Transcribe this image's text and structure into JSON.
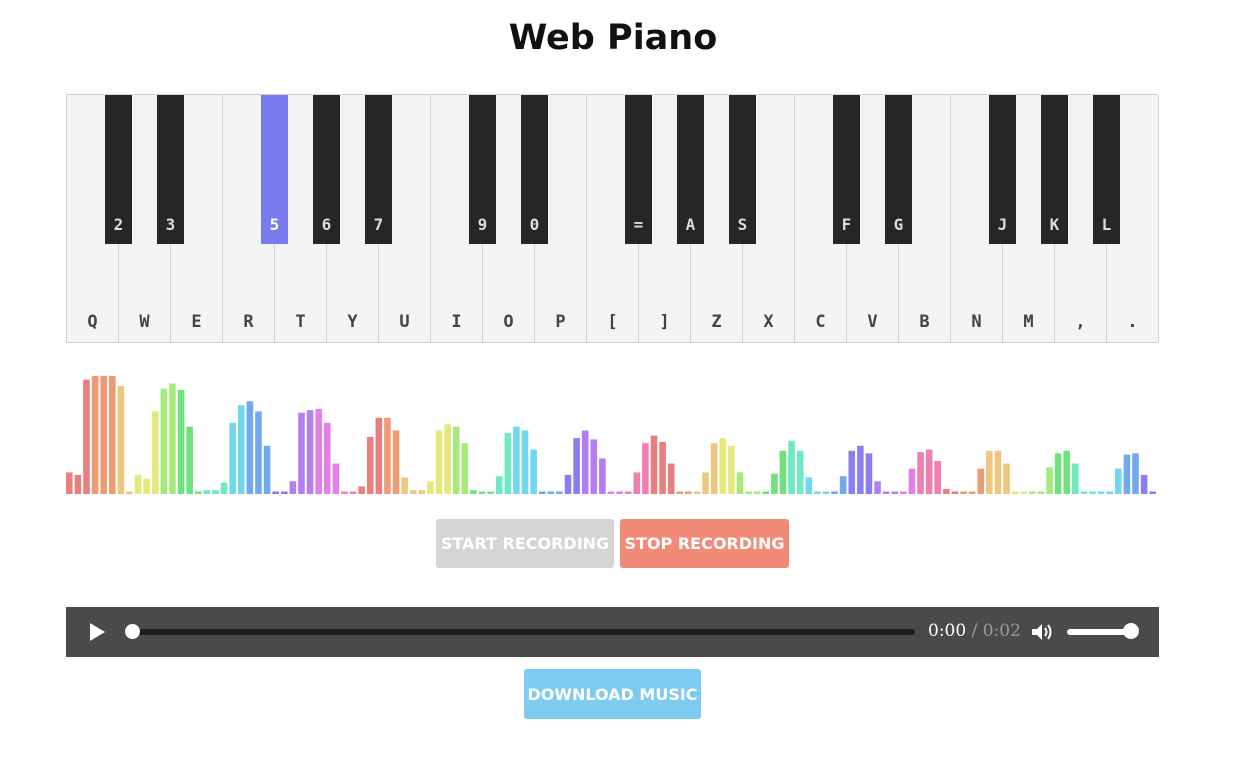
{
  "title": "Web Piano",
  "piano": {
    "white_keys": [
      "Q",
      "W",
      "E",
      "R",
      "T",
      "Y",
      "U",
      "I",
      "O",
      "P",
      "[",
      "]",
      "Z",
      "X",
      "C",
      "V",
      "B",
      "N",
      "M",
      ",",
      "."
    ],
    "black_keys": [
      {
        "label": "2",
        "after_white": 1
      },
      {
        "label": "3",
        "after_white": 2
      },
      {
        "label": "5",
        "after_white": 4,
        "active": true
      },
      {
        "label": "6",
        "after_white": 5
      },
      {
        "label": "7",
        "after_white": 6
      },
      {
        "label": "9",
        "after_white": 8
      },
      {
        "label": "0",
        "after_white": 9
      },
      {
        "label": "=",
        "after_white": 11
      },
      {
        "label": "A",
        "after_white": 12
      },
      {
        "label": "S",
        "after_white": 13
      },
      {
        "label": "F",
        "after_white": 15
      },
      {
        "label": "G",
        "after_white": 16
      },
      {
        "label": "J",
        "after_white": 18
      },
      {
        "label": "K",
        "after_white": 19
      },
      {
        "label": "L",
        "after_white": 20
      }
    ],
    "active_key_color": "#7b7bf0"
  },
  "visualizer": {
    "levels": [
      17,
      15,
      90,
      93,
      93,
      93,
      85,
      2,
      15,
      12,
      65,
      83,
      87,
      82,
      53,
      2,
      3,
      3,
      9,
      56,
      70,
      73,
      65,
      38,
      2,
      2,
      10,
      64,
      66,
      67,
      56,
      24,
      2,
      2,
      6,
      45,
      60,
      60,
      50,
      13,
      3,
      3,
      10,
      50,
      55,
      53,
      40,
      3,
      2,
      2,
      14,
      48,
      53,
      50,
      35,
      2,
      2,
      2,
      15,
      44,
      50,
      43,
      28,
      2,
      2,
      2,
      17,
      40,
      46,
      41,
      24,
      2,
      2,
      2,
      17,
      40,
      44,
      38,
      17,
      2,
      2,
      2,
      16,
      34,
      42,
      34,
      13,
      2,
      2,
      2,
      14,
      34,
      38,
      32,
      10,
      2,
      2,
      2,
      20,
      33,
      35,
      26,
      4,
      2,
      2,
      2,
      20,
      34,
      34,
      24,
      2,
      2,
      2,
      2,
      21,
      32,
      34,
      24,
      2,
      2,
      2,
      2,
      20,
      31,
      32,
      15,
      2
    ],
    "palette": [
      "#e87f7f",
      "#ee9a72",
      "#eec77e",
      "#e6e87c",
      "#a7ea7c",
      "#6fe27d",
      "#6fe9c3",
      "#71d7ee",
      "#72a8ee",
      "#8b7ff0",
      "#b27ef0",
      "#e27fe8",
      "#ee7fb0"
    ]
  },
  "recording": {
    "start_label": "START RECORDING",
    "stop_label": "STOP RECORDING"
  },
  "player": {
    "current_time": "0:00",
    "separator": " / ",
    "duration": "0:02",
    "progress": 0.0,
    "volume": 1.0
  },
  "download_label": "DOWNLOAD MUSIC"
}
